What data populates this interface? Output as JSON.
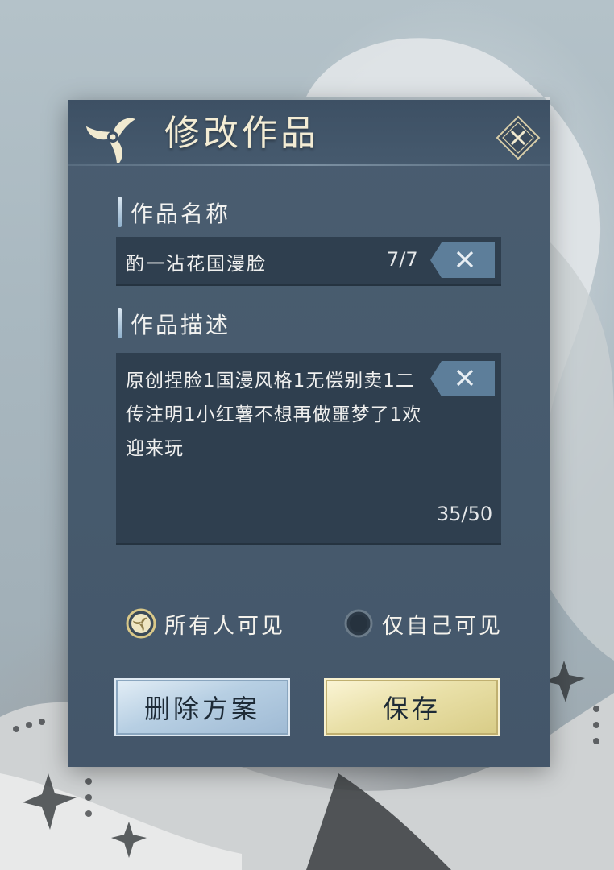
{
  "dialog": {
    "title": "修改作品",
    "close_icon": "close-diamond-icon"
  },
  "name_section": {
    "label": "作品名称",
    "value": "酌一沾花国漫脸",
    "counter": "7/7",
    "clear_icon": "clear-x-icon"
  },
  "desc_section": {
    "label": "作品描述",
    "value": "原创捏脸1国漫风格1无偿别卖1二传注明1小红薯不想再做噩梦了1欢迎来玩",
    "counter": "35/50",
    "clear_icon": "clear-x-icon"
  },
  "visibility": {
    "options": [
      "所有人可见",
      "仅自己可见"
    ],
    "selected": "所有人可见"
  },
  "buttons": {
    "delete_label": "删除方案",
    "save_label": "保存"
  },
  "colors": {
    "panel": "#4a5d70",
    "field": "#2f3f4f",
    "title": "#f3ecd4",
    "clear_button": "#5d7e9a",
    "delete_button": "#b7cfe3",
    "save_button": "#e9e0a8"
  }
}
